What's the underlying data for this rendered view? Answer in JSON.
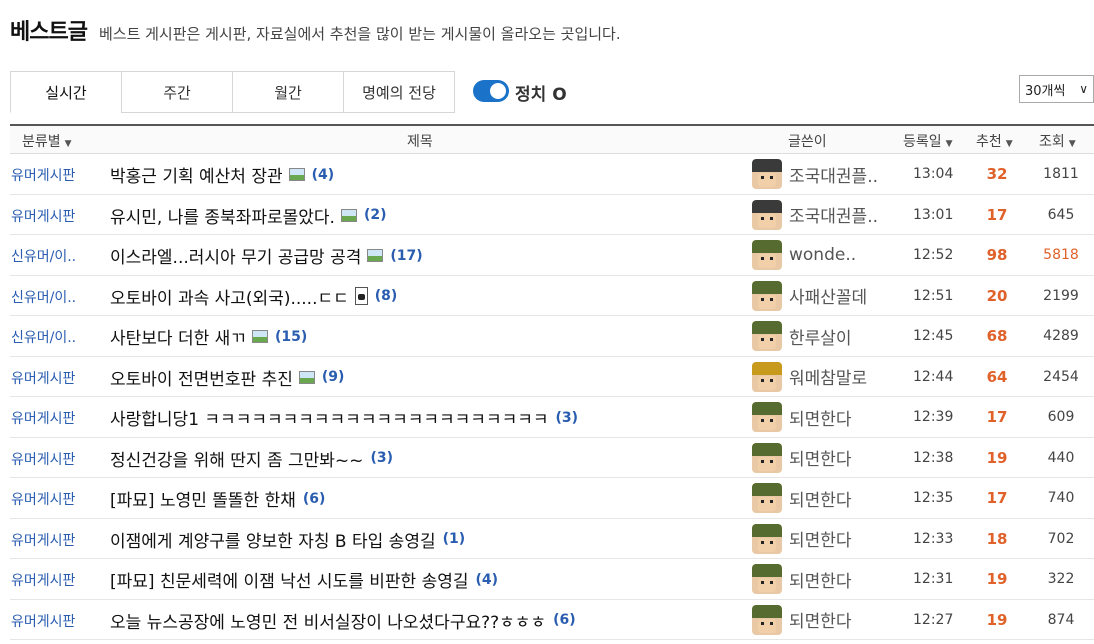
{
  "header": {
    "title": "베스트글",
    "description": "베스트 게시판은 게시판, 자료실에서 추천을 많이 받는 게시물이 올라오는 곳입니다."
  },
  "tabs": [
    "실시간",
    "주간",
    "월간",
    "명예의 전당"
  ],
  "toggle": {
    "label": "정치 O",
    "on": true,
    "color": "#1a73c8"
  },
  "per_page": {
    "selected": "30개씩"
  },
  "table": {
    "headers": {
      "category": "분류별",
      "subject": "제목",
      "author": "글쓴이",
      "date": "등록일",
      "recommend": "추천",
      "views": "조회"
    },
    "rows": [
      {
        "category": "유머게시판",
        "subject": "박홍근 기획 예산처 장관",
        "media": "image",
        "comments": "(4)",
        "author": "조국대권플..",
        "avatar": "dark",
        "date": "13:04",
        "recommend": "32",
        "views": "1811",
        "hot": false
      },
      {
        "category": "유머게시판",
        "subject": "유시민, 나를 종북좌파로몰았다.",
        "media": "image",
        "comments": "(2)",
        "author": "조국대권플..",
        "avatar": "dark",
        "date": "13:01",
        "recommend": "17",
        "views": "645",
        "hot": false
      },
      {
        "category": "신유머/이..",
        "subject": "이스라엘...러시아 무기 공급망 공격",
        "media": "image",
        "comments": "(17)",
        "author": "wonde..",
        "avatar": "green",
        "date": "12:52",
        "recommend": "98",
        "views": "5818",
        "hot": true
      },
      {
        "category": "신유머/이..",
        "subject": "오토바이 과속 사고(외국).....ㄷㄷ",
        "media": "video",
        "comments": "(8)",
        "author": "사패산꼴데",
        "avatar": "green",
        "date": "12:51",
        "recommend": "20",
        "views": "2199",
        "hot": false
      },
      {
        "category": "신유머/이..",
        "subject": "사탄보다 더한 새ㄲ",
        "media": "image",
        "comments": "(15)",
        "author": "한루살이",
        "avatar": "green",
        "date": "12:45",
        "recommend": "68",
        "views": "4289",
        "hot": false
      },
      {
        "category": "유머게시판",
        "subject": "오토바이 전면번호판 추진",
        "media": "image",
        "comments": "(9)",
        "author": "워메참말로",
        "avatar": "gold",
        "date": "12:44",
        "recommend": "64",
        "views": "2454",
        "hot": false
      },
      {
        "category": "유머게시판",
        "subject": "사랑합니당1 ㅋㅋㅋㅋㅋㅋㅋㅋㅋㅋㅋㅋㅋㅋㅋㅋㅋㅋㅋㅋㅋㅋ",
        "media": "",
        "comments": "(3)",
        "author": "되면한다",
        "avatar": "green",
        "date": "12:39",
        "recommend": "17",
        "views": "609",
        "hot": false
      },
      {
        "category": "유머게시판",
        "subject": "정신건강을 위해 딴지 좀 그만봐~~",
        "media": "",
        "comments": "(3)",
        "author": "되면한다",
        "avatar": "green",
        "date": "12:38",
        "recommend": "19",
        "views": "440",
        "hot": false
      },
      {
        "category": "유머게시판",
        "subject": "[파묘] 노영민 똘똘한 한채",
        "media": "",
        "comments": "(6)",
        "author": "되면한다",
        "avatar": "green",
        "date": "12:35",
        "recommend": "17",
        "views": "740",
        "hot": false
      },
      {
        "category": "유머게시판",
        "subject": "이잼에게 계양구를 양보한 자칭 B 타입 송영길",
        "media": "",
        "comments": "(1)",
        "author": "되면한다",
        "avatar": "green",
        "date": "12:33",
        "recommend": "18",
        "views": "702",
        "hot": false
      },
      {
        "category": "유머게시판",
        "subject": "[파묘] 친문세력에 이잼 낙선 시도를 비판한 송영길",
        "media": "",
        "comments": "(4)",
        "author": "되면한다",
        "avatar": "green",
        "date": "12:31",
        "recommend": "19",
        "views": "322",
        "hot": false
      },
      {
        "category": "유머게시판",
        "subject": "오늘 뉴스공장에 노영민 전 비서실장이 나오셨다구요??ㅎㅎㅎ",
        "media": "",
        "comments": "(6)",
        "author": "되면한다",
        "avatar": "green",
        "date": "12:27",
        "recommend": "19",
        "views": "874",
        "hot": false
      }
    ]
  },
  "colors": {
    "link": "#2a5db0",
    "recommend": "#e0622a",
    "accent": "#1a73c8"
  }
}
